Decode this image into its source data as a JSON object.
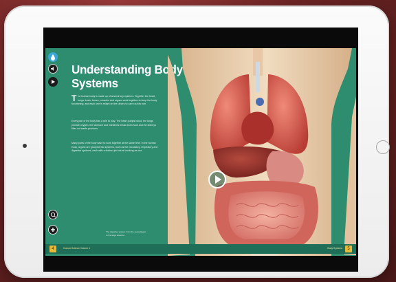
{
  "book": {
    "title": "Understanding Body Systems",
    "intro_dropcap": "T",
    "paragraphs": [
      "he human body is made up of several key systems. Together the heart, lungs, brain, bones, muscles and organs work together to keep the body functioning, and each one is reliant on the others to carry out its role.",
      "Every part of the body has a role to play. The heart pumps blood, the lungs provide oxygen, the stomach and intestines break down food and the kidneys filter out waste products.",
      "Many parts of the body have to work together at the same time. In the human body, organs are grouped into systems, such as the circulatory, respiratory and digestive systems, each with a distinct job but all working as one."
    ],
    "caption": "The digestive system, from the oesophagus to the large intestine.",
    "footer_left": "Human Science Volume 1",
    "footer_right": "Body Systems",
    "page_left": "4",
    "page_right": "5"
  },
  "controls": {
    "audio_icon": "speaker-icon",
    "play_icon": "play-icon",
    "zoom_icon": "magnifier-icon",
    "add_icon": "plus-icon",
    "brand_icon": "drop-icon"
  },
  "colors": {
    "page_bg": "#2e8d6f",
    "accent": "#e7b93a"
  }
}
